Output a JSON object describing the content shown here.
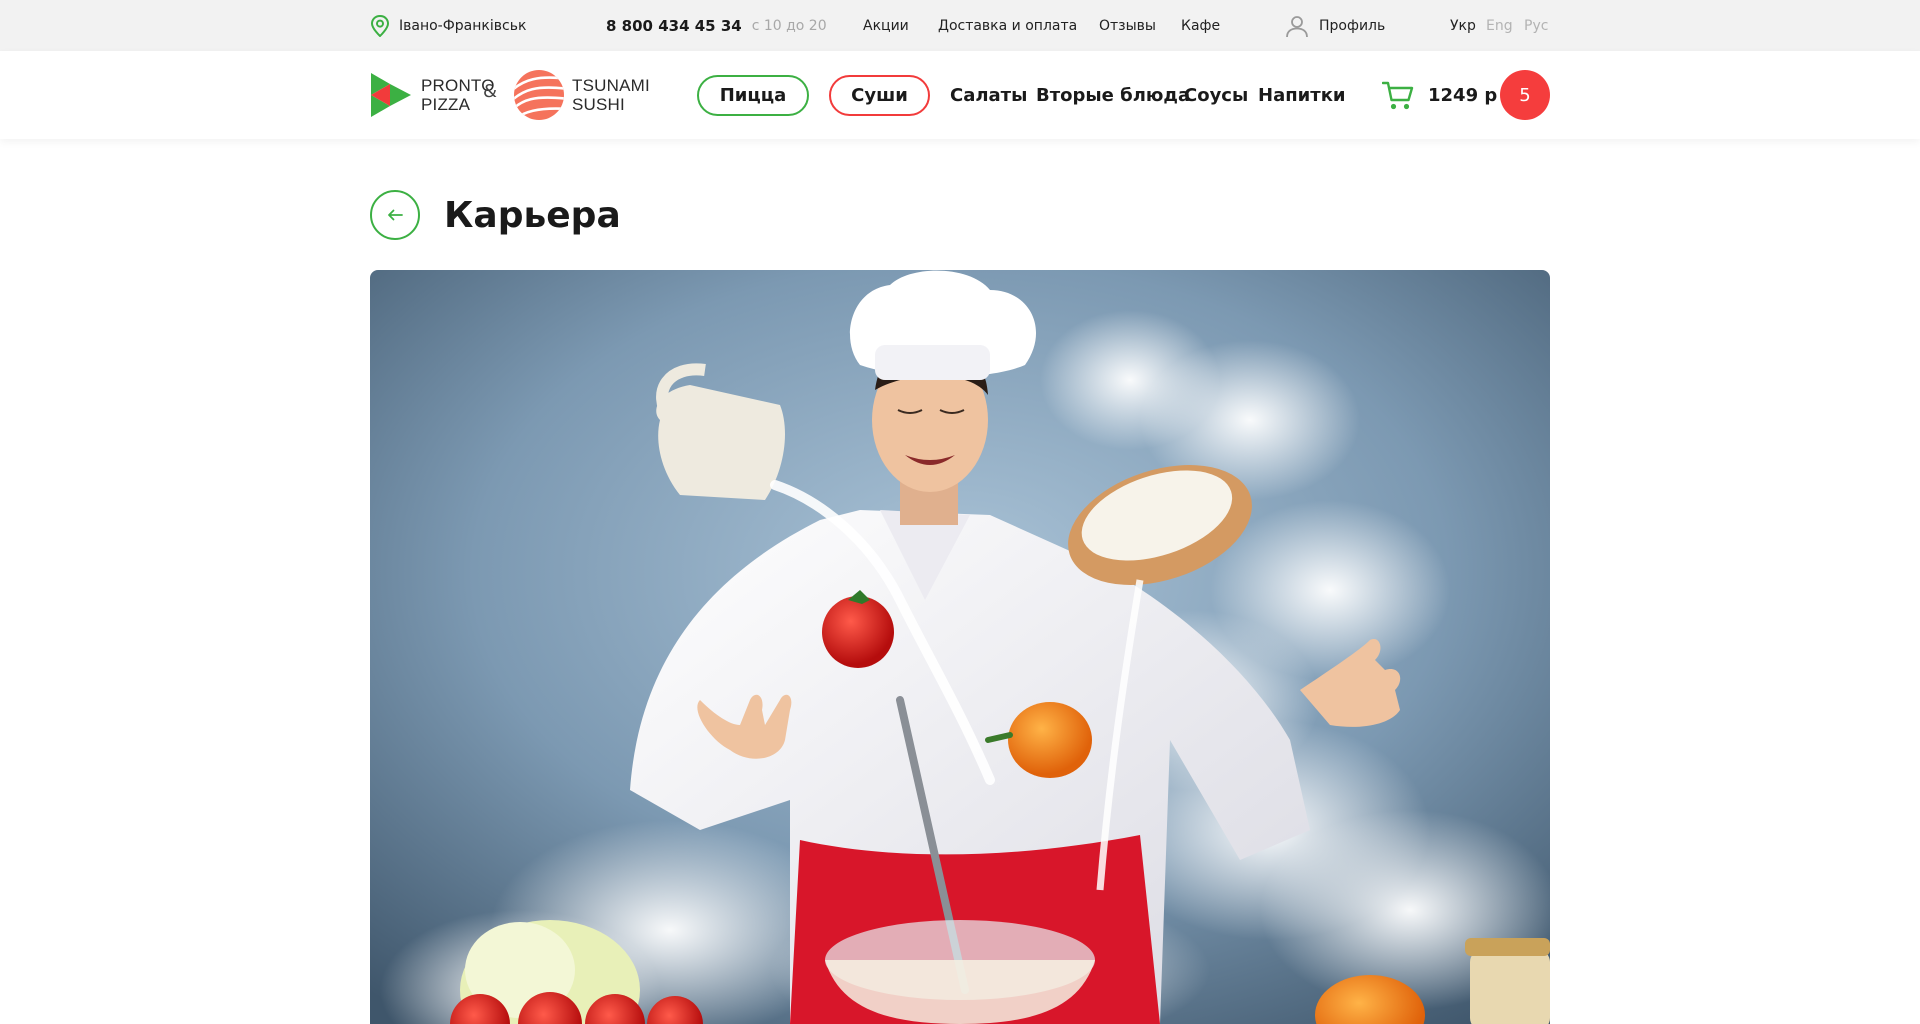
{
  "topbar": {
    "city": "Івано-Франківськ",
    "phone": "8 800 434 45 34",
    "hours": "с 10 до 20",
    "links": [
      {
        "label": "Акции"
      },
      {
        "label": "Доставка и оплата"
      },
      {
        "label": "Отзывы"
      },
      {
        "label": "Кафе"
      }
    ],
    "profile": "Профиль",
    "languages": [
      {
        "label": "Укр",
        "active": true
      },
      {
        "label": "Eng",
        "active": false
      },
      {
        "label": "Рус",
        "active": false
      }
    ]
  },
  "header": {
    "logo_pronto": {
      "line1": "PRONTO",
      "line2": "PIZZA"
    },
    "amp": "&",
    "logo_tsunami": {
      "line1": "TSUNAMI",
      "line2": "SUSHI"
    },
    "nav": {
      "pizza": "Пицца",
      "sushi": "Суши",
      "salads": "Салаты",
      "main_dishes": "Вторые блюда",
      "sauces": "Соусы",
      "drinks": "Напитки"
    },
    "cart": {
      "total": "1249 р",
      "count": "5"
    }
  },
  "page": {
    "title": "Карьера"
  },
  "hero": {
    "icon": "chef-photo"
  },
  "colors": {
    "green": "#3cb043",
    "red": "#f23b3b",
    "cart_badge": "#f53d3d",
    "topbar_bg": "#f2f2f2"
  }
}
